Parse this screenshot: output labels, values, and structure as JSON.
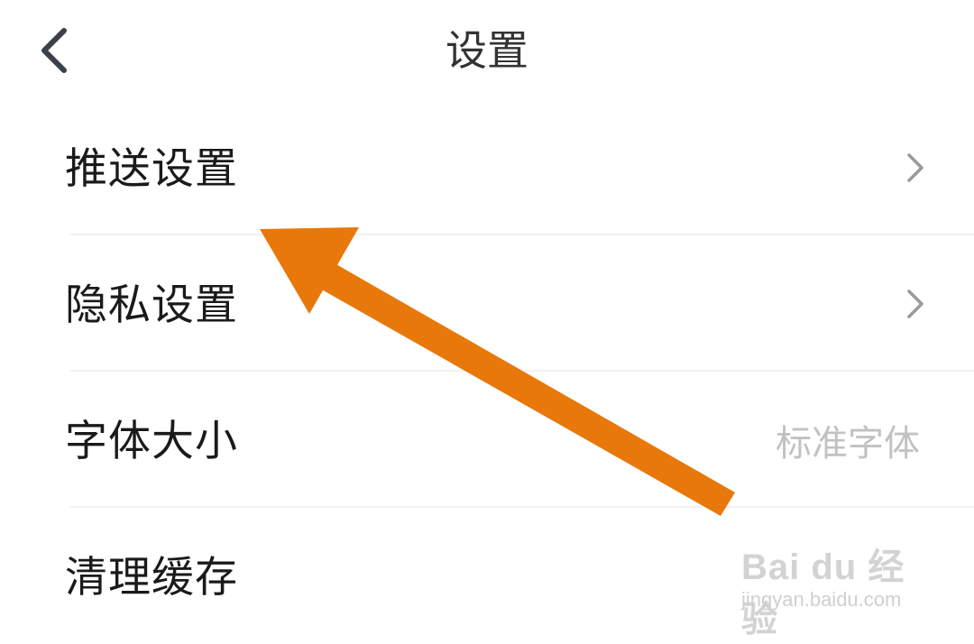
{
  "header": {
    "title": "设置",
    "back_icon": "chevron-left-icon"
  },
  "settings": {
    "items": [
      {
        "label": "推送设置",
        "value": "",
        "icon": "chevron-right-icon"
      },
      {
        "label": "隐私设置",
        "value": "",
        "icon": "chevron-right-icon"
      },
      {
        "label": "字体大小",
        "value": "标准字体"
      },
      {
        "label": "清理缓存",
        "value": ""
      }
    ]
  },
  "annotation": {
    "arrow_color": "#E8780A"
  },
  "watermark": {
    "logo": "Bai du 经验",
    "url": "jingyan.baidu.com"
  }
}
